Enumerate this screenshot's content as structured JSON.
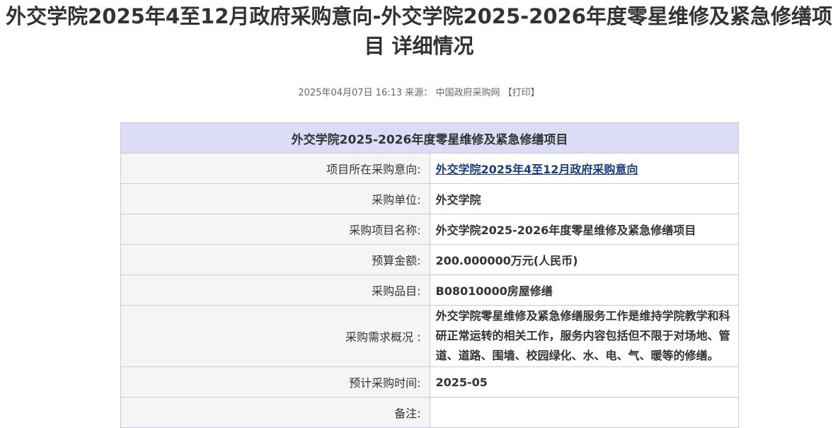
{
  "page": {
    "title": "外交学院2025年4至12月政府采购意向-外交学院2025-2026年度零星维修及紧急修缮项目 详细情况"
  },
  "meta": {
    "datetime": "2025年04月07日 16:13",
    "source_label": "来源：",
    "source": "中国政府采购网",
    "print": "【打印】"
  },
  "table": {
    "header": "外交学院2025-2026年度零星维修及紧急修缮项目",
    "rows": [
      {
        "label": "项目所在采购意向:",
        "value": "外交学院2025年4至12月政府采购意向"
      },
      {
        "label": "采购单位:",
        "value": "外交学院"
      },
      {
        "label": "采购项目名称:",
        "value": "外交学院2025-2026年度零星维修及紧急修缮项目"
      },
      {
        "label": "预算金额:",
        "value": "200.000000万元(人民币)"
      },
      {
        "label": "采购品目:",
        "value": "B08010000房屋修缮"
      },
      {
        "label": "采购需求概况 :",
        "value": "外交学院零星维修及紧急修缮服务工作是维持学院教学和科研正常运转的相关工作，服务内容包括但不限于对场地、管道、道路、围墙、校园绿化、水、电、气、暖等的修缮。"
      },
      {
        "label": "预计采购时间:",
        "value": "2025-05"
      },
      {
        "label": "备注:",
        "value": ""
      }
    ]
  }
}
